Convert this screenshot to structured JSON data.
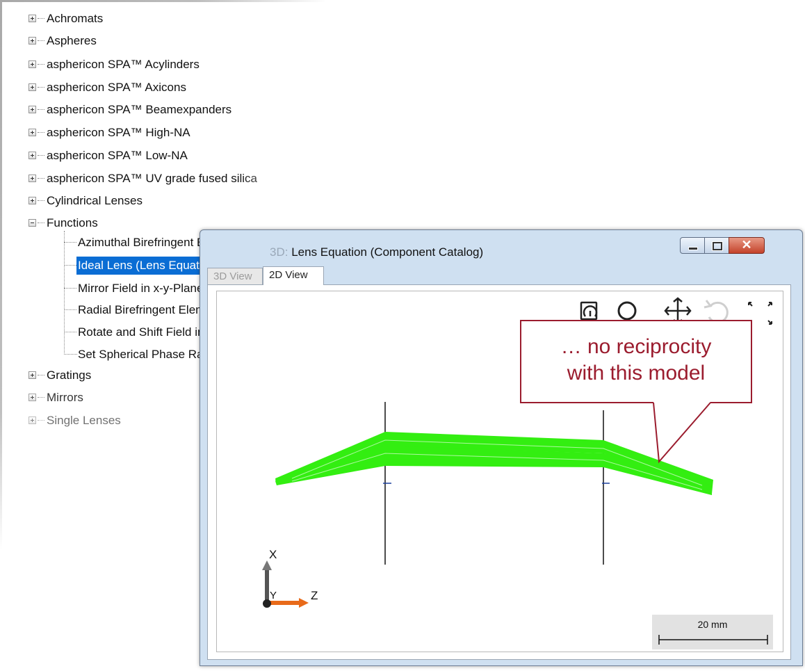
{
  "tree": {
    "items": [
      {
        "label": "Achromats",
        "expanded": false
      },
      {
        "label": "Aspheres",
        "expanded": false
      },
      {
        "label": "asphericon SPA™ Acylinders",
        "expanded": false
      },
      {
        "label": "asphericon SPA™ Axicons",
        "expanded": false
      },
      {
        "label": "asphericon SPA™ Beamexpanders",
        "expanded": false
      },
      {
        "label": "asphericon SPA™ High-NA",
        "expanded": false
      },
      {
        "label": "asphericon SPA™ Low-NA",
        "expanded": false
      },
      {
        "label": "asphericon SPA™ UV grade fused silica",
        "expanded": false
      },
      {
        "label": "Cylindrical Lenses",
        "expanded": false
      },
      {
        "label": "Functions",
        "expanded": true
      },
      {
        "label": "Gratings",
        "expanded": false
      },
      {
        "label": "Mirrors",
        "expanded": false
      },
      {
        "label": "Single Lenses",
        "expanded": false
      }
    ],
    "functions_children": [
      {
        "label": "Azimuthal Birefringent Element"
      },
      {
        "label": "Ideal Lens (Lens Equation)",
        "selected": true
      },
      {
        "label": "Mirror Field in x-y-Plane"
      },
      {
        "label": "Radial Birefringent Element"
      },
      {
        "label": "Rotate and Shift Field in x-y-Plane"
      },
      {
        "label": "Set Spherical Phase Radius"
      }
    ]
  },
  "window": {
    "title": "Lens Equation (Component Catalog)",
    "title_prefix_hidden": "3D:",
    "close_glyph": "✕",
    "tabs": [
      {
        "label": "3D View",
        "active": false
      },
      {
        "label": "2D View",
        "active": true
      }
    ]
  },
  "toolbar_icons": [
    "snapshot-icon",
    "zoom-icon",
    "pan-icon",
    "rotate-icon",
    "fit-to-view-icon"
  ],
  "axes": {
    "x_label": "X",
    "y_label": "Y",
    "z_label": "Z"
  },
  "scale_bar": {
    "label": "20 mm"
  },
  "callout": {
    "line1": "… no reciprocity",
    "line2": "with this model"
  },
  "colors": {
    "ray": "#33ee11",
    "selection": "#0a6dd4",
    "callout": "#9b1c2e",
    "window_frame": "#cfe0f1"
  }
}
